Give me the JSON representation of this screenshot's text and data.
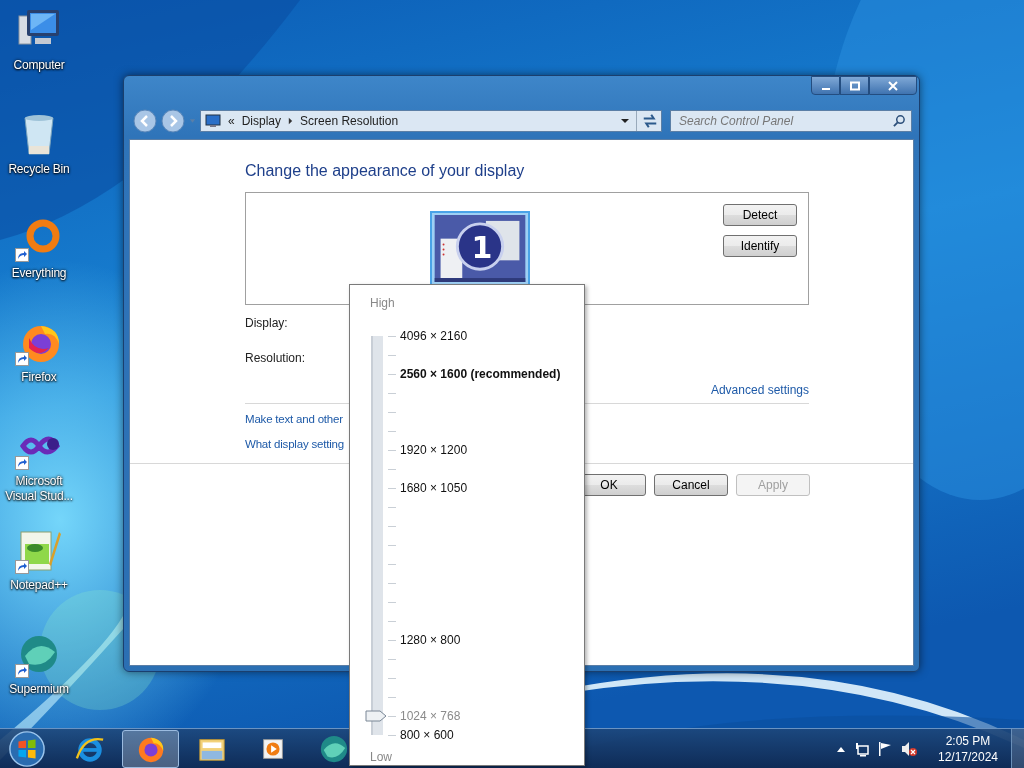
{
  "desktop_icons": [
    {
      "label": "Computer",
      "kind": "computer",
      "shortcut": false
    },
    {
      "label": "Recycle Bin",
      "kind": "recycle-bin",
      "shortcut": false
    },
    {
      "label": "Everything",
      "kind": "ring",
      "shortcut": true
    },
    {
      "label": "Firefox",
      "kind": "firefox",
      "shortcut": true
    },
    {
      "label": "Microsoft Visual Stud...",
      "kind": "infinity",
      "shortcut": true
    },
    {
      "label": "Notepad++",
      "kind": "notepad",
      "shortcut": true
    },
    {
      "label": "Supermium",
      "kind": "supermium",
      "shortcut": true
    }
  ],
  "window": {
    "address_bar": {
      "overflow": "«",
      "crumbs": [
        "Display",
        "Screen Resolution"
      ]
    },
    "search": {
      "placeholder": "Search Control Panel"
    },
    "heading": "Change the appearance of your display",
    "monitor": {
      "number": "1",
      "selected": true
    },
    "side_buttons": [
      {
        "label": "Detect"
      },
      {
        "label": "Identify"
      }
    ],
    "fields": [
      {
        "label": "Display:"
      },
      {
        "label": "Resolution:"
      }
    ],
    "advanced_link": "Advanced settings",
    "links": [
      "Make text and other",
      "What display setting"
    ],
    "buttons": [
      {
        "label": "OK",
        "disabled": false
      },
      {
        "label": "Cancel",
        "disabled": false
      },
      {
        "label": "Apply",
        "disabled": true
      }
    ]
  },
  "resolution_popup": {
    "high_label": "High",
    "low_label": "Low",
    "level": 0.048,
    "options": [
      {
        "label": "4096 × 2160",
        "kind": "normal",
        "selected": false
      },
      {
        "label": "2560 × 1600 (recommended)",
        "kind": "recommended",
        "selected": false
      },
      {
        "label": "1920 × 1200",
        "kind": "normal",
        "selected": false
      },
      {
        "label": "1680 × 1050",
        "kind": "normal",
        "selected": false
      },
      {
        "label": "1280 × 800",
        "kind": "normal",
        "selected": false
      },
      {
        "label": "1024 × 768",
        "kind": "normal",
        "selected": true
      },
      {
        "label": "800 × 600",
        "kind": "normal",
        "selected": false
      }
    ]
  },
  "taskbar": {
    "apps": [
      {
        "kind": "ie",
        "active": false
      },
      {
        "kind": "firefox",
        "active": true
      },
      {
        "kind": "folder",
        "active": false
      },
      {
        "kind": "media",
        "active": false
      },
      {
        "kind": "supermium",
        "active": false
      }
    ],
    "clock": {
      "time": "2:05 PM",
      "date": "12/17/2024"
    }
  }
}
